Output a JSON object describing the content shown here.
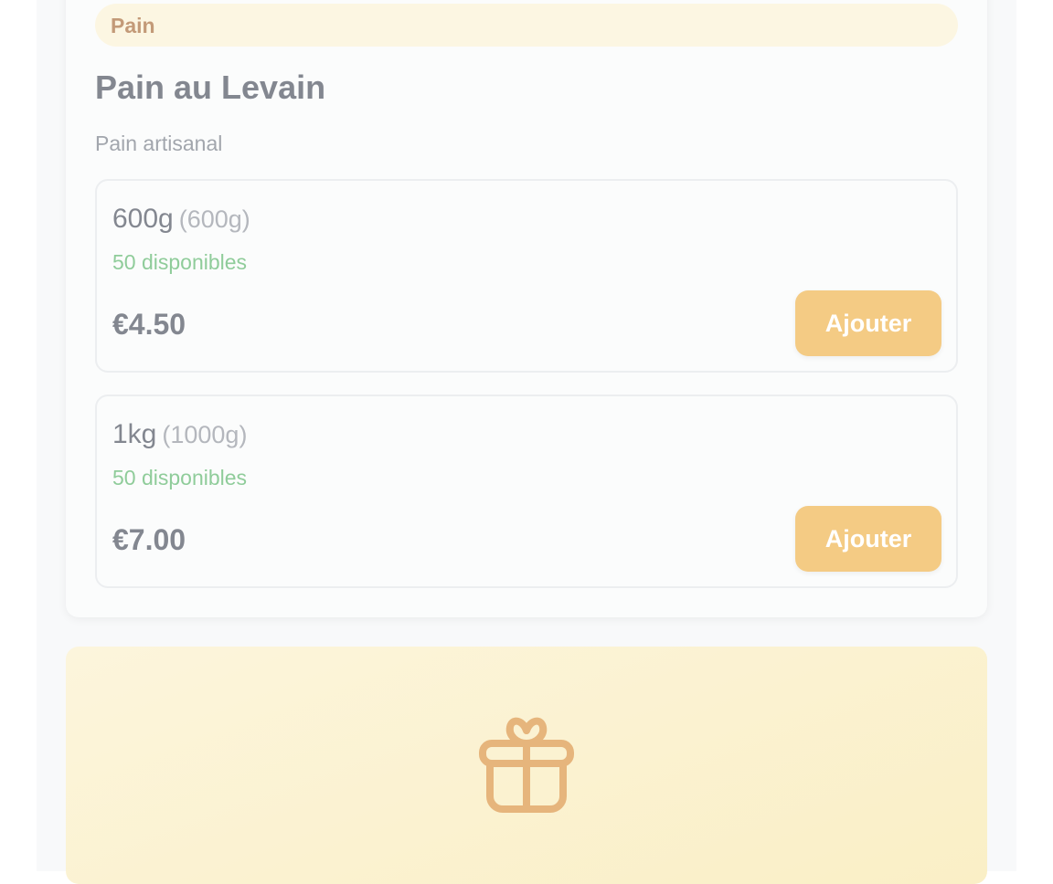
{
  "product": {
    "category": "Pain",
    "title": "Pain au Levain",
    "description": "Pain artisanal",
    "variants": [
      {
        "name": "600g",
        "weight": "(600g)",
        "stock": "50 disponibles",
        "price": "€4.50",
        "button_label": "Ajouter"
      },
      {
        "name": "1kg",
        "weight": "(1000g)",
        "stock": "50 disponibles",
        "price": "€7.00",
        "button_label": "Ajouter"
      }
    ]
  },
  "promo": {
    "icon": "gift-icon"
  },
  "colors": {
    "accent": "#f4cb84",
    "category_bg": "#fcf6e2",
    "category_text": "#c39a78",
    "stock_green": "#8fcc9a",
    "gift_icon": "#e6b57c",
    "promo_bg": "#faefc6"
  }
}
